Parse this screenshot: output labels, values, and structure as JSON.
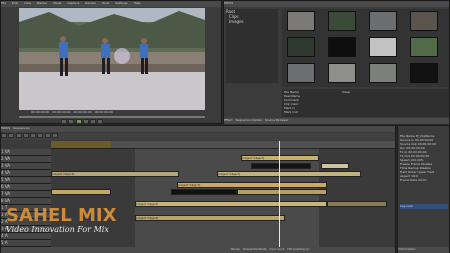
{
  "player": {
    "title": "PLR REC",
    "menu": [
      "File",
      "Edit",
      "View",
      "Marker",
      "Mode",
      "Capture",
      "Render",
      "Tools",
      "Settings",
      "Help"
    ],
    "timecodes": [
      "00:00:00;00",
      "00:00:00;00",
      "00:00:00;00",
      "00:00:00;00"
    ]
  },
  "bin": {
    "title": "EDIUS",
    "folder_tree": [
      "Root",
      "Clips",
      "Images"
    ],
    "clips": [
      {
        "label": "clip 01"
      },
      {
        "label": "clip 02"
      },
      {
        "label": "clip 03"
      },
      {
        "label": "clip 04"
      },
      {
        "label": "clip 05"
      },
      {
        "label": "clip 06"
      },
      {
        "label": "clip 07"
      },
      {
        "label": "clip 08"
      },
      {
        "label": "clip 09"
      },
      {
        "label": "clip 10"
      },
      {
        "label": "clip 11"
      },
      {
        "label": "clip 12"
      }
    ],
    "props_left": [
      "File Name",
      "Reel Name",
      "Comment",
      "Clip Color",
      "Mark In",
      "Mark Out",
      "Duration"
    ],
    "props_right": [
      "Silver",
      "",
      "",
      "",
      "",
      "",
      ""
    ],
    "tabs": [
      "Effect",
      "Sequence marker",
      "Source Browser"
    ]
  },
  "timeline": {
    "title": "EDIUS",
    "project": "Sequence1",
    "tracks": [
      "1 VA",
      "2 VA",
      "3 VA",
      "4 VA",
      "5 VA",
      "6 VA",
      "7 VA",
      "8 VA",
      "1 T",
      "1 A",
      "2 A",
      "3 A",
      "4 A",
      "5 A"
    ],
    "clips": [
      {
        "label": "0003_Clip"
      },
      {
        "label": "0009_Clip"
      },
      {
        "label": "0005_Clip"
      },
      {
        "label": "0012_Clip"
      },
      {
        "label": "0007_Clip"
      },
      {
        "label": "0004_Clip"
      }
    ],
    "status": [
      "Pause",
      "Overwrite Mode",
      "Sync Lock",
      "HD Loading on"
    ]
  },
  "info_panel": {
    "rows": [
      {
        "k": "File Name",
        "v": "IP_ClipName"
      },
      {
        "k": "Source In",
        "v": "00:00:00;00"
      },
      {
        "k": "Source Out",
        "v": "00:00:00;00"
      },
      {
        "k": "Dur",
        "v": "00:00:00;00"
      },
      {
        "k": "TL In",
        "v": "00:00:00;00"
      },
      {
        "k": "TL Out",
        "v": "00:00:00;00"
      },
      {
        "k": "Speed",
        "v": "100.00%"
      },
      {
        "k": "Freeze Frame",
        "v": "Disable"
      },
      {
        "k": "Time Remap",
        "v": "Disable"
      },
      {
        "k": "Field Order",
        "v": "Upper Field"
      },
      {
        "k": "Aspect",
        "v": "16:9"
      },
      {
        "k": "Frame Rate",
        "v": "29.97"
      }
    ],
    "layer_label": "Layouter",
    "tab": "Information"
  },
  "watermark": {
    "brand": "SAHEL MIX",
    "tagline": "Video Innovation For Mix"
  }
}
